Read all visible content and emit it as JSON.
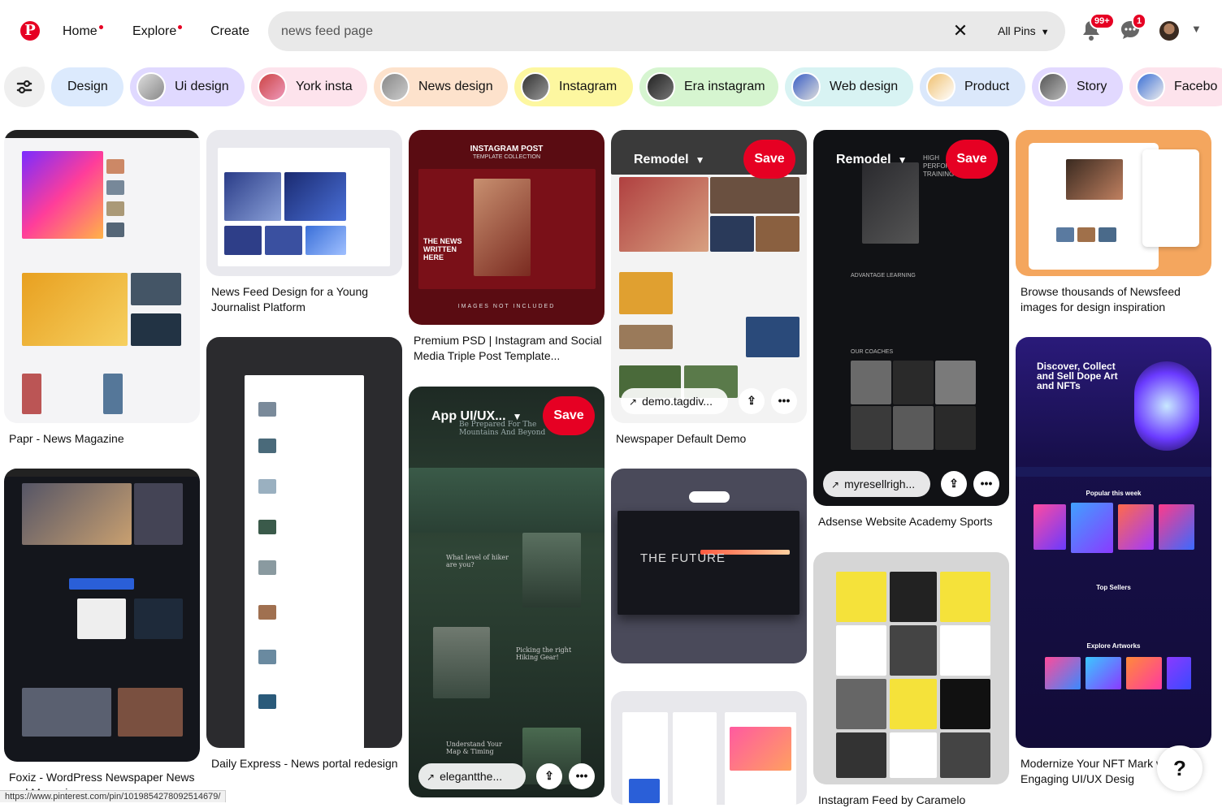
{
  "header": {
    "logo": "P",
    "nav": [
      {
        "label": "Home",
        "dot": true
      },
      {
        "label": "Explore",
        "dot": true
      },
      {
        "label": "Create",
        "dot": false
      }
    ],
    "search": {
      "value": "news feed page",
      "placeholder": "Search"
    },
    "scope": "All Pins",
    "notifications_badge": "99+",
    "messages_badge": "1"
  },
  "chips": [
    "Design",
    "Ui design",
    "York insta",
    "News design",
    "Instagram",
    "Era instagram",
    "Web design",
    "Product",
    "Story",
    "Facebo"
  ],
  "pins": [
    {
      "title": "Papr - News Magazine"
    },
    {
      "title": "Foxiz - WordPress Newspaper News and Magazine"
    },
    {
      "title": "News Feed Design for a Young Journalist Platform"
    },
    {
      "title": "Daily Express - News portal redesign"
    },
    {
      "title": "Premium PSD | Instagram and Social Media Triple Post Template..."
    },
    {
      "title": "App UI/UX...",
      "overlay": true,
      "link": "elegantthe..."
    },
    {
      "title": "Newspaper Default Demo",
      "board": "Remodel",
      "link": "demo.tagdiv..."
    },
    {
      "title": "",
      "image_text": "THE FUTURE"
    },
    {
      "title": "Adsense Website Academy Sports",
      "board": "Remodel",
      "link": "myresellrigh..."
    },
    {
      "title": "Instagram Feed by Caramelo"
    },
    {
      "title": "Browse thousands of Newsfeed images for design inspiration"
    },
    {
      "title": "Modernize Your NFT Mark with Engaging UI/UX Desig"
    }
  ],
  "pin_image_text": {
    "instagram_top": "INSTAGRAM POST",
    "instagram_sub": "TEMPLATE COLLECTION",
    "instagram_headline": "THE NEWS WRITTEN HERE",
    "instagram_footer": "IMAGES NOT INCLUDED",
    "hiker_head": "Be Prepared For The Mountains And Beyond",
    "hiker_q1": "What level of hiker are you?",
    "hiker_q2": "Picking the right Hiking Gear!",
    "hiker_q3": "Understand Your Map & Timing",
    "nft_head": "Discover, Collect and Sell Dope Art and NFTs",
    "nft_popular": "Popular this week",
    "nft_sellers": "Top Sellers",
    "nft_explore": "Explore Artworks",
    "sports_head": "HIGH PERFORMANCE TRAINING",
    "sports_adv": "ADVANTAGE LEARNING",
    "sports_coaches": "OUR COACHES"
  },
  "buttons": {
    "save": "Save",
    "more": "•••",
    "share": "⇪",
    "help": "?"
  },
  "status_url": "https://www.pinterest.com/pin/1019854278092514679/",
  "colors": {
    "brand": "#e60023",
    "search_bg": "#e9e9e9"
  }
}
